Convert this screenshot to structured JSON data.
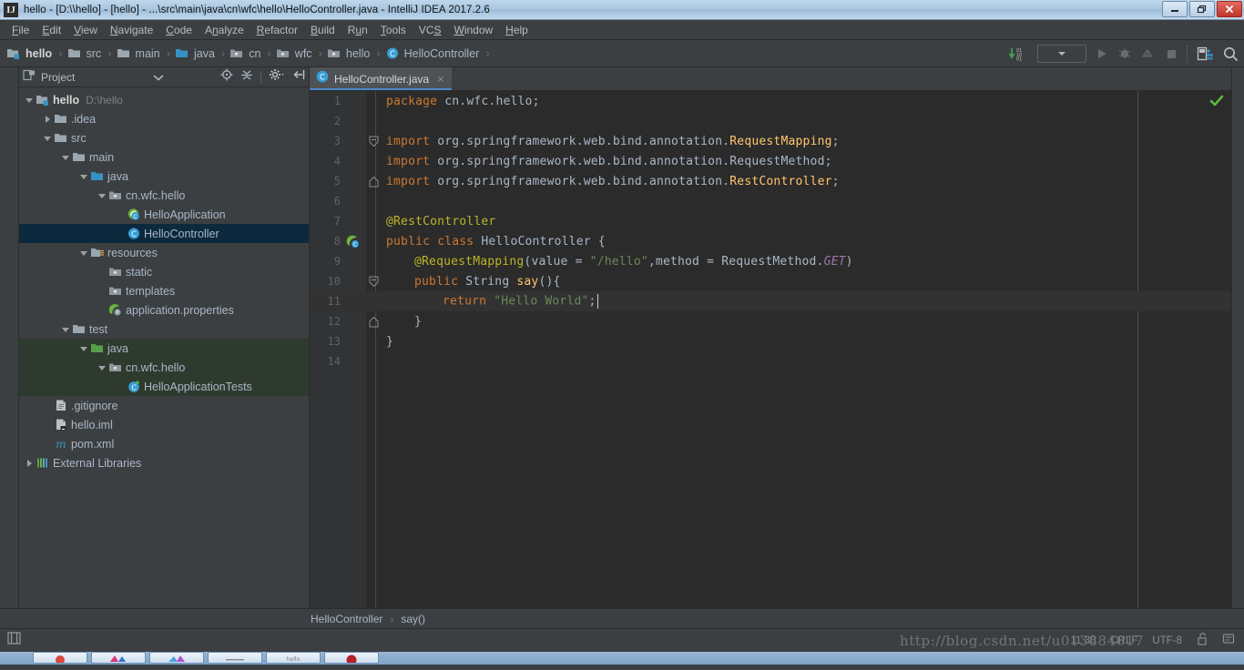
{
  "window": {
    "title": "hello - [D:\\\\hello] - [hello] - ...\\src\\main\\java\\cn\\wfc\\hello\\HelloController.java - IntelliJ IDEA 2017.2.6",
    "app_icon": "intellij-idea-icon",
    "minimize_label": "minimize-icon",
    "maximize_label": "restore-icon",
    "close_label": "close-icon"
  },
  "menubar": {
    "items": [
      {
        "label": "File",
        "mnemonic": "F"
      },
      {
        "label": "Edit",
        "mnemonic": "E"
      },
      {
        "label": "View",
        "mnemonic": "V"
      },
      {
        "label": "Navigate",
        "mnemonic": "N"
      },
      {
        "label": "Code",
        "mnemonic": "C"
      },
      {
        "label": "Analyze",
        "mnemonic": "A"
      },
      {
        "label": "Refactor",
        "mnemonic": "R"
      },
      {
        "label": "Build",
        "mnemonic": "B"
      },
      {
        "label": "Run",
        "mnemonic": "R"
      },
      {
        "label": "Tools",
        "mnemonic": "T"
      },
      {
        "label": "VCS",
        "mnemonic": "S"
      },
      {
        "label": "Window",
        "mnemonic": "W"
      },
      {
        "label": "Help",
        "mnemonic": "H"
      }
    ]
  },
  "navbar": {
    "crumbs": [
      {
        "label": "hello",
        "icon": "module-icon"
      },
      {
        "label": "src",
        "icon": "folder-icon"
      },
      {
        "label": "main",
        "icon": "folder-icon"
      },
      {
        "label": "java",
        "icon": "source-root-icon"
      },
      {
        "label": "cn",
        "icon": "package-icon"
      },
      {
        "label": "wfc",
        "icon": "package-icon"
      },
      {
        "label": "hello",
        "icon": "package-icon"
      },
      {
        "label": "HelloController",
        "icon": "class-icon"
      }
    ],
    "separator": "›",
    "tools": [
      {
        "name": "update-project-icon"
      },
      {
        "name": "run-configuration-dropdown"
      },
      {
        "name": "run-icon"
      },
      {
        "name": "debug-icon"
      },
      {
        "name": "coverage-icon"
      },
      {
        "name": "stop-icon"
      },
      {
        "name": "layout-icon"
      },
      {
        "name": "search-icon"
      }
    ]
  },
  "project_panel": {
    "title": "Project",
    "dropdown_icon": "chevron-down-icon",
    "header_buttons": [
      {
        "name": "locate-icon"
      },
      {
        "name": "collapse-all-icon"
      },
      {
        "name": "settings-gear-icon"
      },
      {
        "name": "hide-panel-icon"
      }
    ],
    "tree": [
      {
        "label": "hello",
        "sub": "D:\\hello",
        "indent": 0,
        "arrow": "down",
        "icon": "module-icon",
        "bold": true,
        "state": "normal"
      },
      {
        "label": ".idea",
        "indent": 1,
        "arrow": "right",
        "icon": "folder-icon",
        "state": "normal"
      },
      {
        "label": "src",
        "indent": 1,
        "arrow": "down",
        "icon": "folder-icon",
        "state": "normal"
      },
      {
        "label": "main",
        "indent": 2,
        "arrow": "down",
        "icon": "folder-icon",
        "state": "normal"
      },
      {
        "label": "java",
        "indent": 3,
        "arrow": "down",
        "icon": "source-root-icon",
        "state": "normal"
      },
      {
        "label": "cn.wfc.hello",
        "indent": 4,
        "arrow": "down",
        "icon": "package-icon",
        "state": "normal"
      },
      {
        "label": "HelloApplication",
        "indent": 5,
        "arrow": "none",
        "icon": "spring-class-icon",
        "state": "normal"
      },
      {
        "label": "HelloController",
        "indent": 5,
        "arrow": "none",
        "icon": "class-icon",
        "state": "selected"
      },
      {
        "label": "resources",
        "indent": 3,
        "arrow": "down",
        "icon": "resource-root-icon",
        "state": "normal"
      },
      {
        "label": "static",
        "indent": 4,
        "arrow": "none",
        "icon": "package-icon",
        "state": "normal"
      },
      {
        "label": "templates",
        "indent": 4,
        "arrow": "none",
        "icon": "package-icon",
        "state": "normal"
      },
      {
        "label": "application.properties",
        "indent": 4,
        "arrow": "none",
        "icon": "spring-prop-icon",
        "state": "normal"
      },
      {
        "label": "test",
        "indent": 2,
        "arrow": "down",
        "icon": "folder-icon",
        "state": "normal"
      },
      {
        "label": "java",
        "indent": 3,
        "arrow": "down",
        "icon": "test-root-icon",
        "state": "testsrc"
      },
      {
        "label": "cn.wfc.hello",
        "indent": 4,
        "arrow": "down",
        "icon": "package-icon",
        "state": "testsrc"
      },
      {
        "label": "HelloApplicationTests",
        "indent": 5,
        "arrow": "none",
        "icon": "test-class-icon",
        "state": "testsrc"
      },
      {
        "label": ".gitignore",
        "indent": 1,
        "arrow": "none",
        "icon": "file-icon",
        "state": "normal"
      },
      {
        "label": "hello.iml",
        "indent": 1,
        "arrow": "none",
        "icon": "iml-file-icon",
        "state": "normal"
      },
      {
        "label": "pom.xml",
        "indent": 1,
        "arrow": "none",
        "icon": "maven-icon",
        "state": "normal"
      },
      {
        "label": "External Libraries",
        "indent": 0,
        "arrow": "right",
        "icon": "libraries-icon",
        "state": "normal"
      }
    ]
  },
  "editor": {
    "tab": {
      "label": "HelloController.java",
      "icon": "class-icon",
      "close": "×"
    },
    "lines": [
      {
        "num": "1",
        "fold": "none",
        "gutter": "none",
        "tokens": [
          {
            "t": "package ",
            "c": "kw"
          },
          {
            "t": "cn",
            "c": "pln"
          },
          {
            "t": ".",
            "c": "punc"
          },
          {
            "t": "wfc",
            "c": "pln"
          },
          {
            "t": ".",
            "c": "punc"
          },
          {
            "t": "hello",
            "c": "pln"
          },
          {
            "t": ";",
            "c": "punc"
          }
        ],
        "indent": 0
      },
      {
        "num": "2",
        "fold": "none",
        "gutter": "none",
        "tokens": [],
        "indent": 0
      },
      {
        "num": "3",
        "fold": "start",
        "gutter": "none",
        "tokens": [
          {
            "t": "import ",
            "c": "kw"
          },
          {
            "t": "org.springframework.web.bind.annotation.",
            "c": "pln"
          },
          {
            "t": "RequestMapping",
            "c": "cls"
          },
          {
            "t": ";",
            "c": "punc"
          }
        ],
        "indent": 0
      },
      {
        "num": "4",
        "fold": "none",
        "gutter": "none",
        "tokens": [
          {
            "t": "import ",
            "c": "kw"
          },
          {
            "t": "org.springframework.web.bind.annotation.",
            "c": "pln"
          },
          {
            "t": "RequestMethod",
            "c": "pln"
          },
          {
            "t": ";",
            "c": "punc"
          }
        ],
        "indent": 0
      },
      {
        "num": "5",
        "fold": "end",
        "gutter": "none",
        "tokens": [
          {
            "t": "import ",
            "c": "kw"
          },
          {
            "t": "org.springframework.web.bind.annotation.",
            "c": "pln"
          },
          {
            "t": "RestController",
            "c": "cls"
          },
          {
            "t": ";",
            "c": "punc"
          }
        ],
        "indent": 0
      },
      {
        "num": "6",
        "fold": "none",
        "gutter": "none",
        "tokens": [],
        "indent": 0
      },
      {
        "num": "7",
        "fold": "none",
        "gutter": "none",
        "tokens": [
          {
            "t": "@RestController",
            "c": "ann"
          }
        ],
        "indent": 0
      },
      {
        "num": "8",
        "fold": "none",
        "gutter": "spring-bean-icon",
        "tokens": [
          {
            "t": "public ",
            "c": "kw"
          },
          {
            "t": "class ",
            "c": "kw"
          },
          {
            "t": "HelloController",
            "c": "pln"
          },
          {
            "t": " {",
            "c": "punc"
          }
        ],
        "indent": 0
      },
      {
        "num": "9",
        "fold": "none",
        "gutter": "none",
        "tokens": [
          {
            "t": "@RequestMapping",
            "c": "ann"
          },
          {
            "t": "(",
            "c": "punc"
          },
          {
            "t": "value",
            "c": "pln"
          },
          {
            "t": " = ",
            "c": "punc"
          },
          {
            "t": "\"/hello\"",
            "c": "str"
          },
          {
            "t": ",",
            "c": "punc"
          },
          {
            "t": "method",
            "c": "pln"
          },
          {
            "t": " = ",
            "c": "punc"
          },
          {
            "t": "RequestMethod",
            "c": "pln"
          },
          {
            "t": ".",
            "c": "punc"
          },
          {
            "t": "GET",
            "c": "stat"
          },
          {
            "t": ")",
            "c": "punc"
          }
        ],
        "indent": 1
      },
      {
        "num": "10",
        "fold": "start",
        "gutter": "none",
        "tokens": [
          {
            "t": "public ",
            "c": "kw"
          },
          {
            "t": "String ",
            "c": "pln"
          },
          {
            "t": "say",
            "c": "mth"
          },
          {
            "t": "(){",
            "c": "punc"
          }
        ],
        "indent": 1
      },
      {
        "num": "11",
        "fold": "none",
        "gutter": "none",
        "current": true,
        "tokens": [
          {
            "t": "return ",
            "c": "kw"
          },
          {
            "t": "\"Hello World\"",
            "c": "str"
          },
          {
            "t": ";",
            "c": "punc"
          }
        ],
        "indent": 2
      },
      {
        "num": "12",
        "fold": "end",
        "gutter": "none",
        "tokens": [
          {
            "t": "}",
            "c": "punc"
          }
        ],
        "indent": 1
      },
      {
        "num": "13",
        "fold": "none",
        "gutter": "none",
        "tokens": [
          {
            "t": "}",
            "c": "punc"
          }
        ],
        "indent": 0
      },
      {
        "num": "14",
        "fold": "none",
        "gutter": "none",
        "tokens": [],
        "indent": 0
      }
    ],
    "inspection_status": "no-errors-check-icon"
  },
  "breadcrumb_bar": {
    "parts": [
      "HelloController",
      "say()"
    ],
    "separator": "›"
  },
  "statusbar": {
    "toolwindow_toggle": "toolwindow-bars-icon",
    "position": "11:30",
    "line_separator": "CRLF",
    "encoding": "UTF-8",
    "lock_icon": "unlocked-icon",
    "event_log_icon": "event-log-icon"
  },
  "watermark": {
    "text": "http://blog.csdn.net/u013884017"
  },
  "colors": {
    "accent_blue": "#4a88c7",
    "panel_bg": "#3c3f41",
    "editor_bg": "#2b2b2b",
    "gutter_bg": "#313335",
    "selection": "#0d293e",
    "test_source": "#2f3a2f",
    "text": "#a9b7c6",
    "keyword": "#cc7832",
    "string": "#6a8759",
    "annotation": "#bbb529",
    "classname": "#ffc66d",
    "static_field": "#9876aa"
  }
}
